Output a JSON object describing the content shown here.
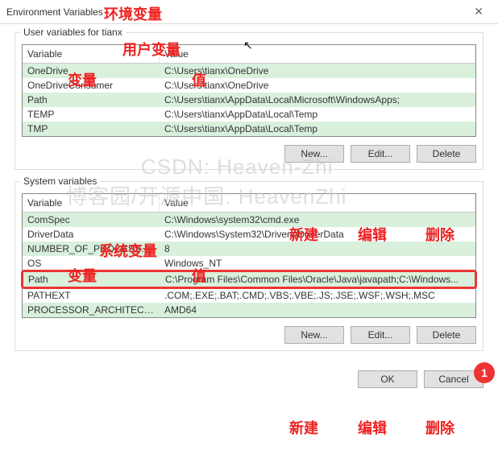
{
  "title": "Environment Variables",
  "userGroup": {
    "label": "User variables for tianx",
    "headers": {
      "var": "Variable",
      "val": "Value"
    },
    "rows": [
      {
        "var": "OneDrive",
        "val": "C:\\Users\\tianx\\OneDrive"
      },
      {
        "var": "OneDriveConsumer",
        "val": "C:\\Users\\tianx\\OneDrive"
      },
      {
        "var": "Path",
        "val": "C:\\Users\\tianx\\AppData\\Local\\Microsoft\\WindowsApps;"
      },
      {
        "var": "TEMP",
        "val": "C:\\Users\\tianx\\AppData\\Local\\Temp"
      },
      {
        "var": "TMP",
        "val": "C:\\Users\\tianx\\AppData\\Local\\Temp"
      }
    ],
    "buttons": {
      "new": "New...",
      "edit": "Edit...",
      "del": "Delete"
    }
  },
  "sysGroup": {
    "label": "System variables",
    "headers": {
      "var": "Variable",
      "val": "Value"
    },
    "rows": [
      {
        "var": "ComSpec",
        "val": "C:\\Windows\\system32\\cmd.exe"
      },
      {
        "var": "DriverData",
        "val": "C:\\Windows\\System32\\Drivers\\DriverData"
      },
      {
        "var": "NUMBER_OF_PROCESSORS",
        "val": "8"
      },
      {
        "var": "OS",
        "val": "Windows_NT"
      },
      {
        "var": "Path",
        "val": "C:\\Program Files\\Common Files\\Oracle\\Java\\javapath;C:\\Windows..."
      },
      {
        "var": "PATHEXT",
        "val": ".COM;.EXE;.BAT;.CMD;.VBS;.VBE;.JS;.JSE;.WSF;.WSH;.MSC"
      },
      {
        "var": "PROCESSOR_ARCHITECTURE",
        "val": "AMD64"
      }
    ],
    "buttons": {
      "new": "New...",
      "edit": "Edit...",
      "del": "Delete"
    }
  },
  "dialog": {
    "ok": "OK",
    "cancel": "Cancel"
  },
  "anno": {
    "title": "环境变量",
    "userVars": "用户变量",
    "sysVars": "系统变量",
    "variable": "变量",
    "value": "值",
    "new": "新建",
    "edit": "编辑",
    "del": "删除",
    "badge": "1"
  },
  "watermark": {
    "line1": "CSDN: Heaven-Zhi",
    "line2": "博客园/开源中国: HeavenZhi"
  }
}
